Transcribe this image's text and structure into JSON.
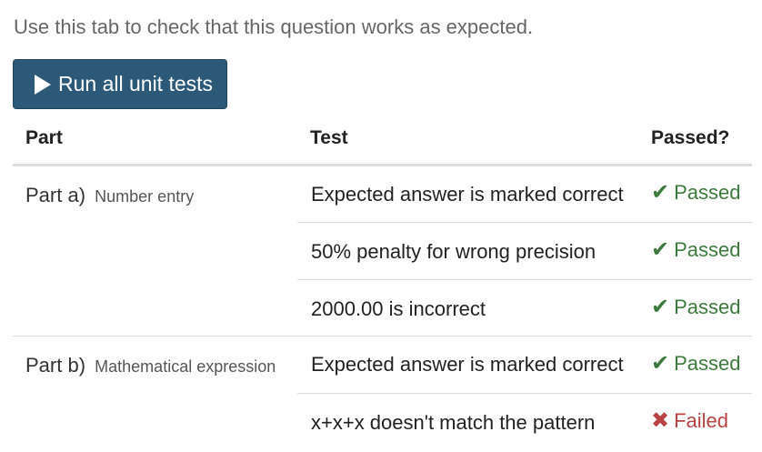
{
  "intro_text": "Use this tab to check that this question works as expected.",
  "run_button": {
    "label": "Run all unit tests",
    "icon": "play-icon"
  },
  "table": {
    "headers": {
      "part": "Part",
      "test": "Test",
      "passed": "Passed?"
    },
    "parts": [
      {
        "name": "Part a)",
        "description": "Number entry",
        "tests": [
          {
            "name": "Expected answer is marked correct",
            "status": "Passed",
            "icon": "check-icon"
          },
          {
            "name": "50% penalty for wrong precision",
            "status": "Passed",
            "icon": "check-icon"
          },
          {
            "name": "2000.00 is incorrect",
            "status": "Passed",
            "icon": "check-icon"
          }
        ]
      },
      {
        "name": "Part b)",
        "description": "Mathematical expression",
        "tests": [
          {
            "name": "Expected answer is marked correct",
            "status": "Passed",
            "icon": "check-icon"
          },
          {
            "name": "x+x+x doesn't match the pattern",
            "status": "Failed",
            "icon": "cross-icon"
          }
        ]
      }
    ]
  },
  "colors": {
    "button_bg": "#2b5977",
    "passed": "#3d7a3d",
    "failed": "#b94343"
  }
}
